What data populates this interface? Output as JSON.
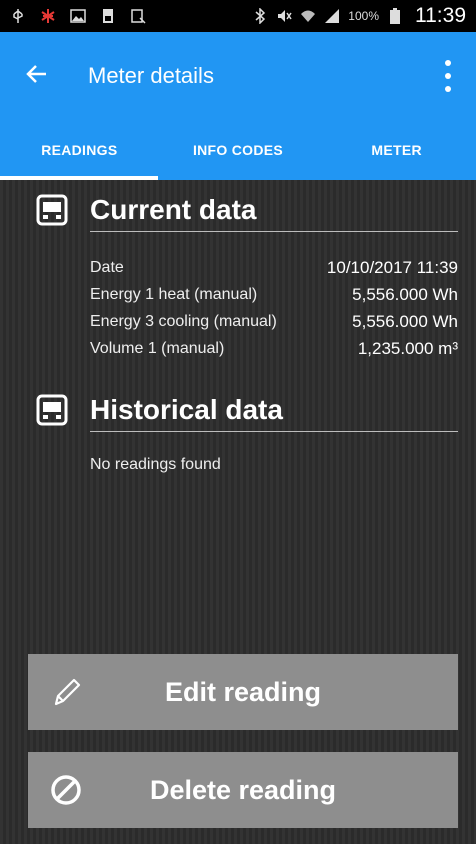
{
  "status_bar": {
    "battery_percent": "100%",
    "time": "11:39",
    "icons": [
      "usb-icon",
      "bug-icon",
      "image-icon",
      "sim-icon",
      "screenshot-icon",
      "bluetooth-icon",
      "mute-icon",
      "wifi-icon",
      "signal-icon",
      "battery-icon"
    ]
  },
  "app_bar": {
    "title": "Meter details",
    "back_icon": "arrow-left-icon",
    "overflow_icon": "more-vert-icon"
  },
  "tabs": [
    {
      "label": "READINGS",
      "active": true
    },
    {
      "label": "INFO CODES",
      "active": false
    },
    {
      "label": "METER",
      "active": false
    }
  ],
  "current_data": {
    "title": "Current data",
    "icon": "card-icon",
    "rows": [
      {
        "label": "Date",
        "value": "10/10/2017 11:39"
      },
      {
        "label": "Energy 1 heat (manual)",
        "value": "5,556.000 Wh"
      },
      {
        "label": "Energy 3 cooling (manual)",
        "value": "5,556.000 Wh"
      },
      {
        "label": "Volume 1 (manual)",
        "value": "1,235.000 m³"
      }
    ]
  },
  "historical_data": {
    "title": "Historical data",
    "icon": "card-icon",
    "empty_text": "No readings found"
  },
  "buttons": {
    "edit": {
      "label": "Edit reading",
      "icon": "pencil-icon"
    },
    "delete": {
      "label": "Delete reading",
      "icon": "block-icon"
    }
  },
  "colors": {
    "primary": "#2196f3",
    "background": "#2f2f2f",
    "button": "#8e8e8e"
  }
}
